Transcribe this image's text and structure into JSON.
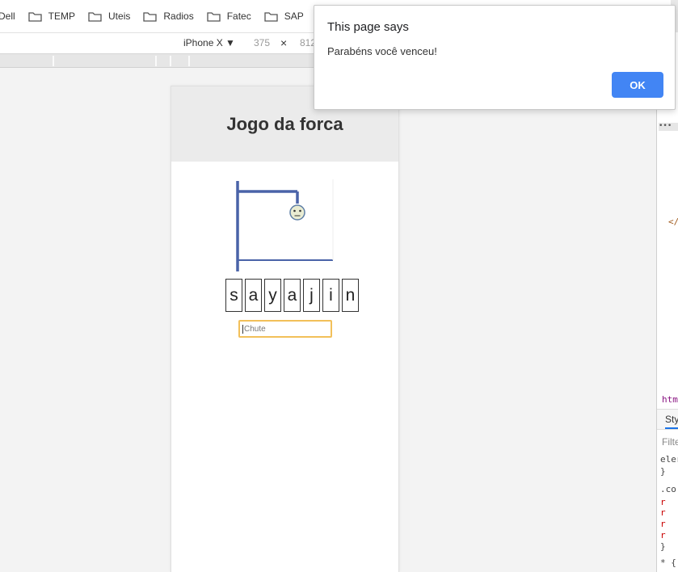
{
  "bookmarks": [
    "Dell",
    "TEMP",
    "Uteis",
    "Radios",
    "Fatec",
    "SAP"
  ],
  "device_toolbar": {
    "device": "iPhone X ▼",
    "width": "375",
    "separator": "×",
    "height": "812"
  },
  "page": {
    "title": "Jogo da forca",
    "letters": [
      "s",
      "a",
      "y",
      "a",
      "j",
      "i",
      "n"
    ],
    "guess_placeholder": "Chute"
  },
  "alert": {
    "title": "This page says",
    "message": "Parabéns você venceu!",
    "ok_label": "OK"
  },
  "devtools": {
    "dots": "•••",
    "close_tag": "</",
    "html_crumb": "htm",
    "styles_tab": "Sty",
    "filter_placeholder": "Filte",
    "lines": [
      "eler",
      "}",
      ".co",
      "}",
      "* {"
    ]
  },
  "colors": {
    "accent": "#4285f4",
    "gallows": "#4a63a8",
    "input_focus": "#f2c05a",
    "header_bg": "#ebebeb"
  },
  "icons": {
    "bookmark": "folder-icon",
    "face": "face-icon"
  }
}
